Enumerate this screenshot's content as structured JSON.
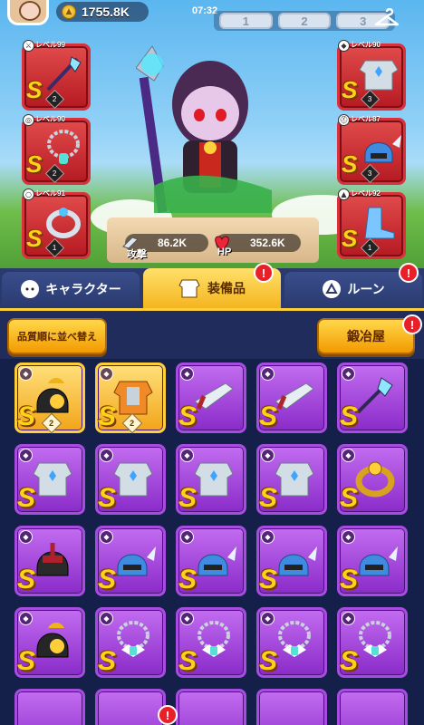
{
  "top": {
    "gold": "1755.8K",
    "clock": "07:32",
    "slots": [
      "1",
      "2",
      "3"
    ]
  },
  "equipped_left": [
    {
      "level": "レベル99",
      "rank": "S",
      "count": "2",
      "icon": "weapon-icon"
    },
    {
      "level": "レベル90",
      "rank": "S",
      "count": "2",
      "icon": "necklace-icon"
    },
    {
      "level": "レベル91",
      "rank": "S",
      "count": "1",
      "icon": "ring-icon"
    }
  ],
  "equipped_right": [
    {
      "level": "レベル90",
      "rank": "S",
      "count": "3",
      "icon": "armor-icon"
    },
    {
      "level": "レベル87",
      "rank": "S",
      "count": "3",
      "icon": "helmet-icon"
    },
    {
      "level": "レベル92",
      "rank": "S",
      "count": "1",
      "icon": "boots-icon"
    }
  ],
  "stats": {
    "attack_label": "攻撃",
    "attack_value": "86.2K",
    "hp_label": "HP",
    "hp_value": "352.6K"
  },
  "tabs": [
    "キャラクター",
    "装備品",
    "ルーン"
  ],
  "actions": {
    "sort_label": "品質順に並べ替え",
    "smith_label": "鍛冶屋"
  },
  "notification_mark": "!",
  "inventory": [
    {
      "item": "helmet-gold",
      "rank": "S",
      "count": "2",
      "frame": "gold"
    },
    {
      "item": "armor-orange",
      "rank": "S",
      "count": "2",
      "frame": "gold"
    },
    {
      "item": "weapon",
      "rank": "S",
      "count": "",
      "frame": "purple"
    },
    {
      "item": "weapon",
      "rank": "S",
      "count": "",
      "frame": "purple"
    },
    {
      "item": "weapon-shuriken",
      "rank": "S",
      "count": "",
      "frame": "purple"
    },
    {
      "item": "armor",
      "rank": "S",
      "count": "",
      "frame": "purple"
    },
    {
      "item": "armor",
      "rank": "S",
      "count": "",
      "frame": "purple"
    },
    {
      "item": "armor",
      "rank": "S",
      "count": "",
      "frame": "purple"
    },
    {
      "item": "armor",
      "rank": "S",
      "count": "",
      "frame": "purple"
    },
    {
      "item": "ring-gold",
      "rank": "S",
      "count": "",
      "frame": "purple"
    },
    {
      "item": "helmet-red",
      "rank": "S",
      "count": "",
      "frame": "purple"
    },
    {
      "item": "helmet-winged",
      "rank": "S",
      "count": "",
      "frame": "purple"
    },
    {
      "item": "helmet-winged",
      "rank": "S",
      "count": "",
      "frame": "purple"
    },
    {
      "item": "helmet-winged",
      "rank": "S",
      "count": "",
      "frame": "purple"
    },
    {
      "item": "helmet-winged",
      "rank": "S",
      "count": "",
      "frame": "purple"
    },
    {
      "item": "helmet-gold",
      "rank": "S",
      "count": "",
      "frame": "purple"
    },
    {
      "item": "necklace",
      "rank": "S",
      "count": "",
      "frame": "purple"
    },
    {
      "item": "necklace",
      "rank": "S",
      "count": "",
      "frame": "purple"
    },
    {
      "item": "necklace",
      "rank": "S",
      "count": "",
      "frame": "purple"
    },
    {
      "item": "necklace",
      "rank": "S",
      "count": "",
      "frame": "purple"
    }
  ]
}
